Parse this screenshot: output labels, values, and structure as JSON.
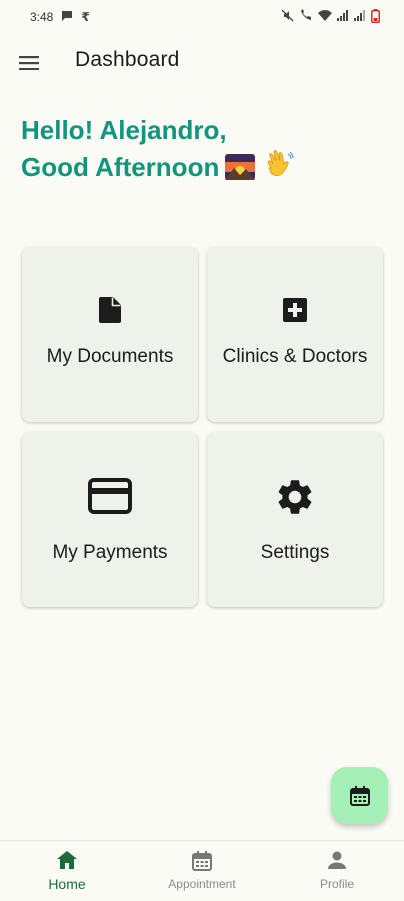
{
  "status_bar": {
    "time": "3:48"
  },
  "app_bar": {
    "title": "Dashboard"
  },
  "greeting": {
    "line1": "Hello! Alejandro,",
    "line2": "Good Afternoon"
  },
  "cards": [
    {
      "label": "My Documents",
      "icon": "document-icon"
    },
    {
      "label": "Clinics & Doctors",
      "icon": "medical-plus-icon"
    },
    {
      "label": "My Payments",
      "icon": "credit-card-icon"
    },
    {
      "label": "Settings",
      "icon": "gear-icon"
    }
  ],
  "fab": {
    "icon": "calendar-icon"
  },
  "bottom_nav": {
    "items": [
      {
        "label": "Home",
        "icon": "home-icon",
        "active": true
      },
      {
        "label": "Appointment",
        "icon": "calendar-icon",
        "active": false
      },
      {
        "label": "Profile",
        "icon": "person-icon",
        "active": false
      }
    ]
  },
  "colors": {
    "background": "#fafbf4",
    "accent_text": "#13957d",
    "card_bg": "#eff2ea",
    "fab_bg": "#a4efb6",
    "nav_active": "#1d6b3b"
  }
}
